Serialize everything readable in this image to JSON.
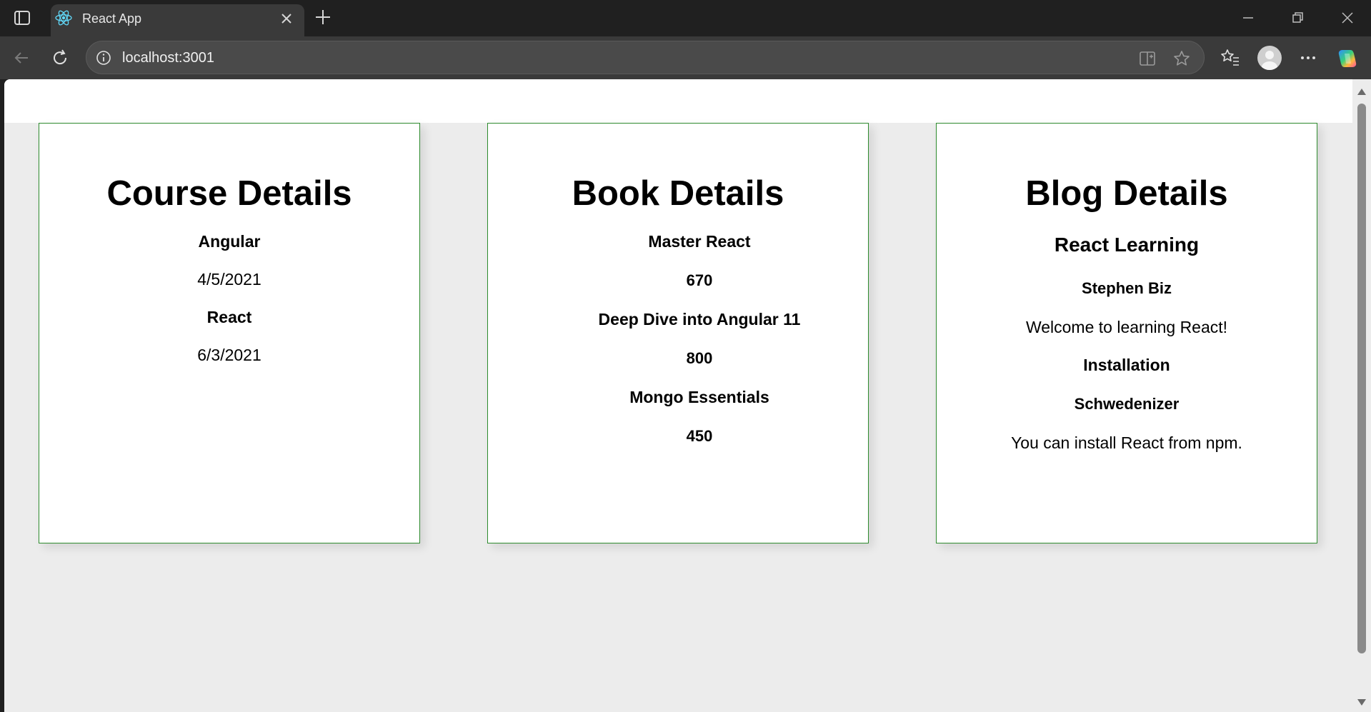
{
  "browser": {
    "tab_title": "React App",
    "url": "localhost:3001"
  },
  "course": {
    "heading": "Course Details",
    "items": [
      {
        "name": "Angular",
        "date": "4/5/2021"
      },
      {
        "name": "React",
        "date": "6/3/2021"
      }
    ]
  },
  "book": {
    "heading": "Book Details",
    "items": [
      {
        "name": "Master React",
        "price": "670"
      },
      {
        "name": "Deep Dive into Angular 11",
        "price": "800"
      },
      {
        "name": "Mongo Essentials",
        "price": "450"
      }
    ]
  },
  "blog": {
    "heading": "Blog Details",
    "items": [
      {
        "title": "React Learning",
        "author": "Stephen Biz",
        "content": "Welcome to learning React!"
      },
      {
        "title": "Installation",
        "author": "Schwedenizer",
        "content": "You can install React from npm."
      }
    ]
  },
  "colors": {
    "card_border": "#2e8b2e",
    "page_background": "#ececec",
    "chrome_dark": "#202020",
    "chrome_toolbar": "#3a3a3a"
  },
  "icons": [
    "tab-actions-icon",
    "react-favicon-icon",
    "close-icon",
    "plus-icon",
    "minimize-icon",
    "restore-icon",
    "back-icon",
    "reload-icon",
    "info-icon",
    "split-screen-icon",
    "star-icon",
    "favorites-icon",
    "profile-icon",
    "more-icon",
    "copilot-icon"
  ]
}
